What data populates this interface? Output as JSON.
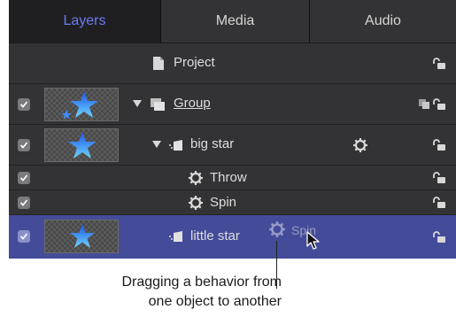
{
  "tabs": [
    {
      "label": "Layers"
    },
    {
      "label": "Media"
    },
    {
      "label": "Audio"
    }
  ],
  "layers": {
    "project_label": "Project",
    "group_label": "Group",
    "big_star_label": "big star",
    "throw_label": "Throw",
    "spin_label": "Spin",
    "little_star_label": "little star",
    "dragged_behavior_label": "Spin"
  },
  "annotation": {
    "line1": "Dragging a behavior from",
    "line2": "one object to another"
  },
  "icons": [
    "checkbox-check-icon",
    "document-icon",
    "group-icon",
    "layer-icon",
    "gear-icon",
    "lock-icon",
    "star-thumbnail",
    "arrow-cursor-icon"
  ],
  "colors": {
    "active_tab": "#6a7cf4",
    "selection": "#444c9a",
    "panel_bg": "#333335"
  }
}
